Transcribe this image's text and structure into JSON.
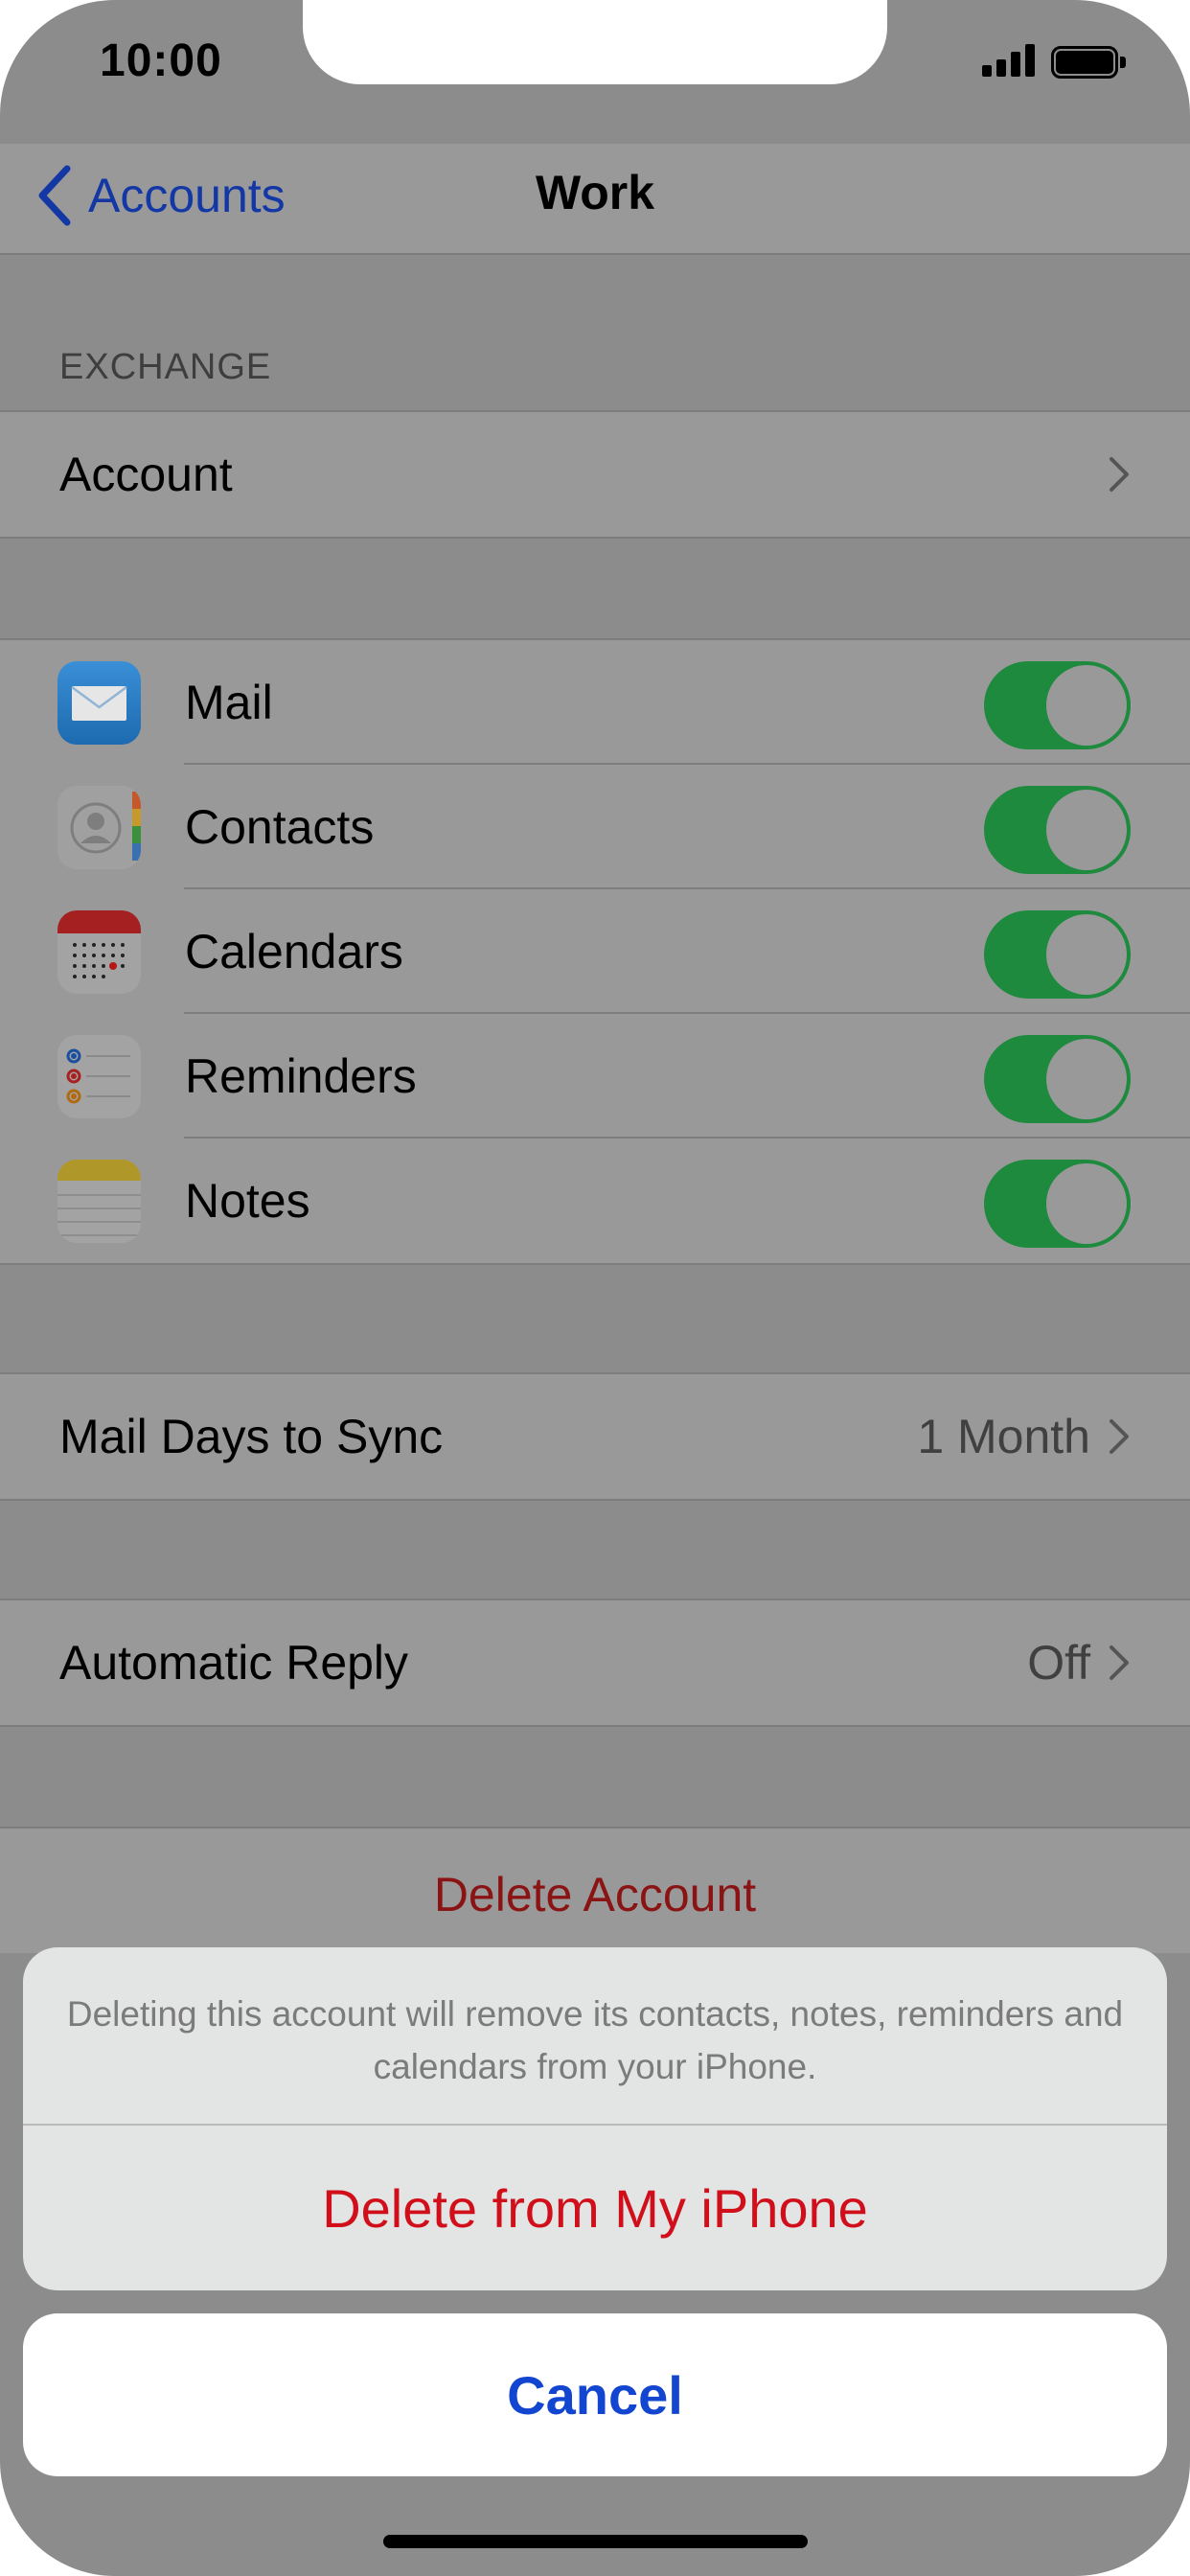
{
  "status_bar": {
    "time": "10:00"
  },
  "nav": {
    "back_label": "Accounts",
    "title": "Work"
  },
  "exchange": {
    "section_title": "EXCHANGE",
    "account_label": "Account"
  },
  "services": [
    {
      "label": "Mail",
      "icon": "mail-icon",
      "enabled": true
    },
    {
      "label": "Contacts",
      "icon": "contacts-icon",
      "enabled": true
    },
    {
      "label": "Calendars",
      "icon": "calendar-icon",
      "enabled": true
    },
    {
      "label": "Reminders",
      "icon": "reminders-icon",
      "enabled": true
    },
    {
      "label": "Notes",
      "icon": "notes-icon",
      "enabled": true
    }
  ],
  "mail_days": {
    "label": "Mail Days to Sync",
    "value": "1 Month"
  },
  "auto_reply": {
    "label": "Automatic Reply",
    "value": "Off"
  },
  "delete_account": {
    "label": "Delete Account"
  },
  "action_sheet": {
    "message": "Deleting this account will remove its contacts, notes, reminders and calendars from your iPhone.",
    "destructive_label": "Delete from My iPhone",
    "cancel_label": "Cancel"
  },
  "colors": {
    "accent": "#1245d0",
    "destructive": "#d10f1b",
    "toggle_on": "#1e8a3d",
    "dim_background": "#8c8c8c"
  }
}
